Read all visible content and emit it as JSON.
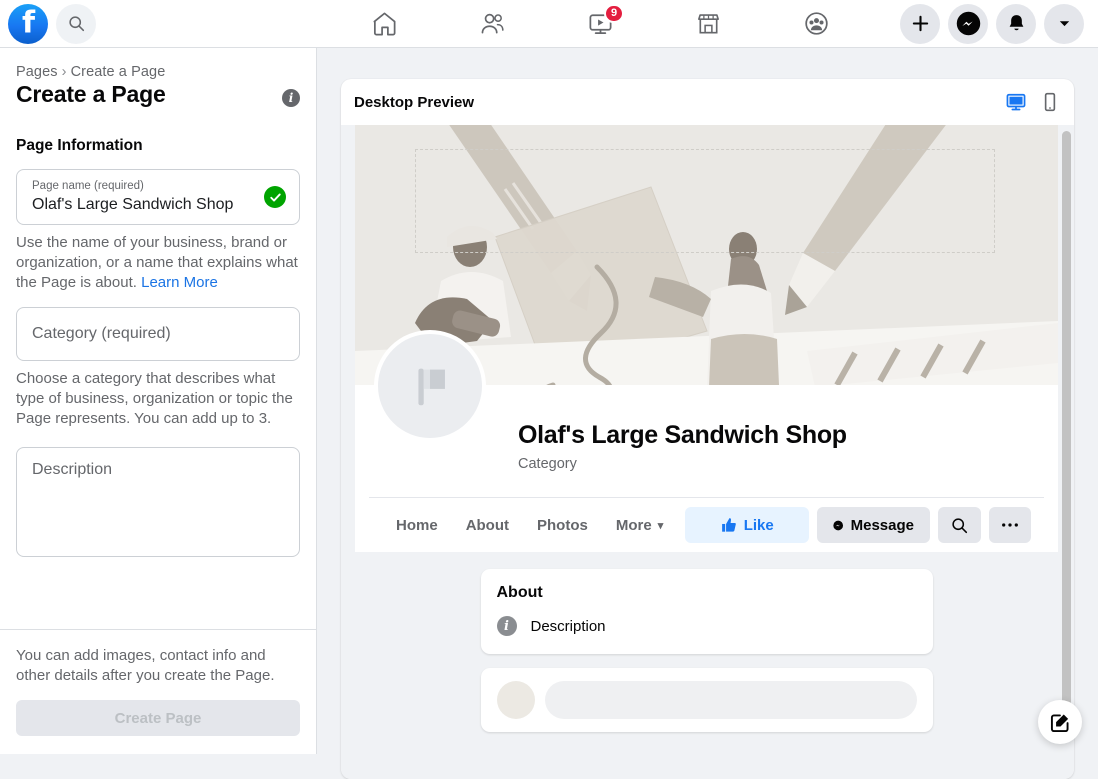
{
  "topbar": {
    "logo": "facebook-logo",
    "search_placeholder": "Search Facebook",
    "nav": [
      {
        "name": "home",
        "icon": "home-icon",
        "badge": ""
      },
      {
        "name": "friends",
        "icon": "friends-icon",
        "badge": ""
      },
      {
        "name": "watch",
        "icon": "video-icon",
        "badge": "9"
      },
      {
        "name": "marketplace",
        "icon": "store-icon",
        "badge": ""
      },
      {
        "name": "groups",
        "icon": "groups-icon",
        "badge": ""
      }
    ],
    "right": [
      {
        "name": "create",
        "icon": "plus-icon"
      },
      {
        "name": "messenger",
        "icon": "messenger-icon"
      },
      {
        "name": "notifications",
        "icon": "bell-icon"
      },
      {
        "name": "account",
        "icon": "chevron-down-icon"
      }
    ]
  },
  "sidebar": {
    "breadcrumb_root": "Pages",
    "breadcrumb_sep": "›",
    "breadcrumb_current": "Create a Page",
    "page_title": "Create a Page",
    "info_icon": "info-icon",
    "section_title": "Page Information",
    "page_name_field": {
      "label": "Page name (required)",
      "value": "Olaf's Large Sandwich Shop",
      "valid_icon": "check-circle-icon"
    },
    "page_name_helper": "Use the name of your business, brand or organization, or a name that explains what the Page is about.",
    "page_name_helper_link": "Learn More",
    "category_field": {
      "placeholder": "Category (required)",
      "value": ""
    },
    "category_helper": "Choose a category that describes what type of business, organization or topic the Page represents. You can add up to 3.",
    "description_field": {
      "placeholder": "Description",
      "value": ""
    },
    "footer_note": "You can add images, contact info and other details after you create the Page.",
    "create_button": "Create Page",
    "create_button_enabled": false
  },
  "preview": {
    "title": "Desktop Preview",
    "desktop_toggle": "desktop-icon",
    "mobile_toggle": "mobile-icon",
    "active_toggle": "desktop",
    "cover_placeholder": "cover-photo-illustration",
    "avatar_placeholder": "flag-icon",
    "page_name": "Olaf's Large Sandwich Shop",
    "page_category": "Category",
    "tabs": [
      {
        "label": "Home"
      },
      {
        "label": "About"
      },
      {
        "label": "Photos"
      },
      {
        "label": "More",
        "caret": "▾"
      }
    ],
    "actions": [
      {
        "name": "like",
        "label": "Like",
        "icon": "thumbs-up-icon"
      },
      {
        "name": "message",
        "label": "Message",
        "icon": "messenger-icon"
      },
      {
        "name": "search",
        "label": "",
        "icon": "search-icon"
      },
      {
        "name": "more",
        "label": "",
        "icon": "ellipsis-icon"
      }
    ],
    "about_card": {
      "title": "About",
      "row_icon": "info-icon",
      "row_text": "Description"
    }
  },
  "fab": {
    "icon": "compose-icon"
  },
  "colors": {
    "brand_blue": "#1877f2",
    "link_blue": "#1b74e4",
    "like_bg": "#e7f3ff",
    "badge_red": "#e41e3f",
    "valid_green": "#00a400",
    "page_bg": "#f0f2f5",
    "grey_btn": "#e4e6eb"
  }
}
